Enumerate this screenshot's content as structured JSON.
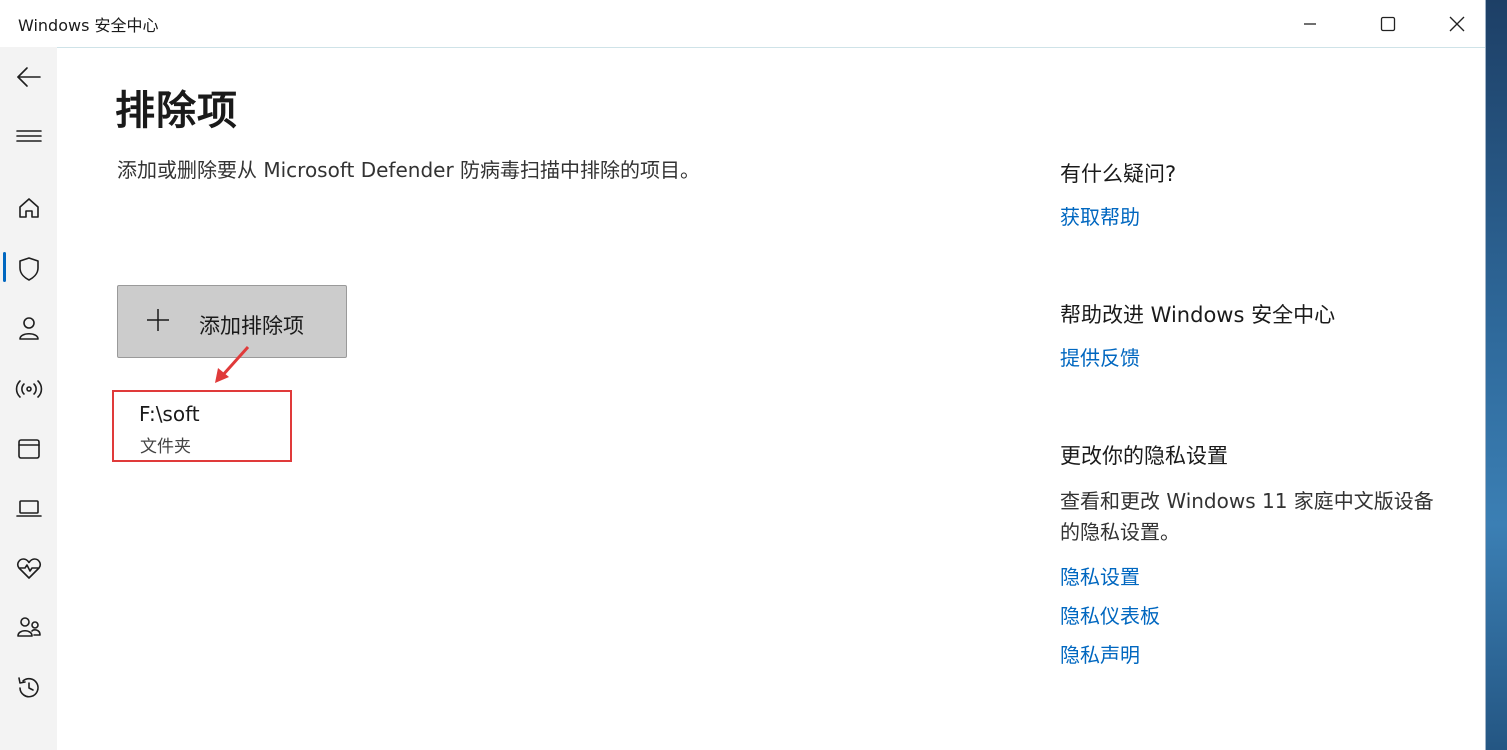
{
  "window": {
    "title": "Windows 安全中心",
    "controls": [
      "minimize",
      "maximize",
      "close"
    ]
  },
  "nav": {
    "items": [
      {
        "icon": "back-arrow-icon"
      },
      {
        "icon": "hamburger-menu-icon"
      },
      {
        "icon": "home-icon"
      },
      {
        "icon": "shield-icon",
        "selected": true
      },
      {
        "icon": "person-icon"
      },
      {
        "icon": "wireless-icon"
      },
      {
        "icon": "app-browser-icon"
      },
      {
        "icon": "laptop-icon"
      },
      {
        "icon": "heart-pulse-icon"
      },
      {
        "icon": "family-icon"
      },
      {
        "icon": "history-icon"
      }
    ],
    "selected_color": "#0067c0"
  },
  "main": {
    "title": "排除项",
    "description": "添加或删除要从 Microsoft Defender 防病毒扫描中排除的项目。",
    "add_button_label": "添加排除项",
    "exclusions": [
      {
        "path": "F:\\soft",
        "type": "文件夹"
      }
    ],
    "annotation_color": "#e03a3a"
  },
  "sidebar": {
    "question_heading": "有什么疑问?",
    "get_help_link": "获取帮助",
    "improve_heading": "帮助改进 Windows 安全中心",
    "feedback_link": "提供反馈",
    "privacy_heading": "更改你的隐私设置",
    "privacy_text": "查看和更改 Windows 11 家庭中文版设备的隐私设置。",
    "privacy_links": [
      "隐私设置",
      "隐私仪表板",
      "隐私声明"
    ],
    "link_color": "#0067c0"
  }
}
